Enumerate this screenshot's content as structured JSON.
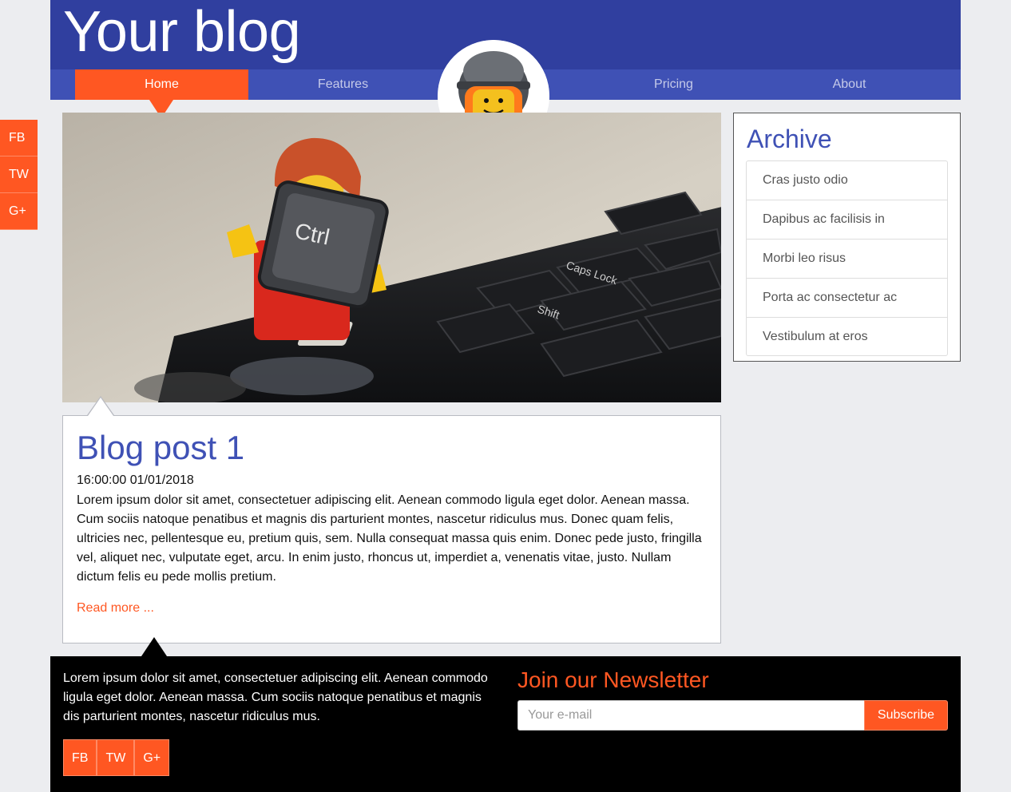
{
  "header": {
    "title": "Your blog"
  },
  "nav": {
    "items": [
      {
        "label": "Home"
      },
      {
        "label": "Features"
      },
      {
        "label": "Pricing"
      },
      {
        "label": "About"
      }
    ]
  },
  "side_share": {
    "fb": "FB",
    "tw": "TW",
    "gp": "G+"
  },
  "post": {
    "title": "Blog post 1",
    "date": "16:00:00 01/01/2018",
    "body": "Lorem ipsum dolor sit amet, consectetuer adipiscing elit. Aenean commodo ligula eget dolor. Aenean massa. Cum sociis natoque penatibus et magnis dis parturient montes, nascetur ridiculus mus. Donec quam felis, ultricies nec, pellentesque eu, pretium quis, sem. Nulla consequat massa quis enim. Donec pede justo, fringilla vel, aliquet nec, vulputate eget, arcu. In enim justo, rhoncus ut, imperdiet a, venenatis vitae, justo. Nullam dictum felis eu pede mollis pretium.",
    "read_more": "Read more ..."
  },
  "hero_image": {
    "key_label": "Ctrl",
    "key2": "Shift",
    "key3": "Caps Lock"
  },
  "archive": {
    "title": "Archive",
    "items": [
      "Cras justo odio",
      "Dapibus ac facilisis in",
      "Morbi leo risus",
      "Porta ac consectetur ac",
      "Vestibulum at eros"
    ]
  },
  "footer": {
    "text": "Lorem ipsum dolor sit amet, consectetuer adipiscing elit. Aenean commodo ligula eget dolor. Aenean massa. Cum sociis natoque penatibus et magnis dis parturient montes, nascetur ridiculus mus.",
    "share": {
      "fb": "FB",
      "tw": "TW",
      "gp": "G+"
    },
    "newsletter_title": "Join our Newsletter",
    "email_placeholder": "Your e-mail",
    "subscribe_label": "Subscribe"
  },
  "colors": {
    "primary": "#3f51b5",
    "primary_dark": "#303f9f",
    "accent": "#ff5722",
    "background": "#ecedf0"
  }
}
